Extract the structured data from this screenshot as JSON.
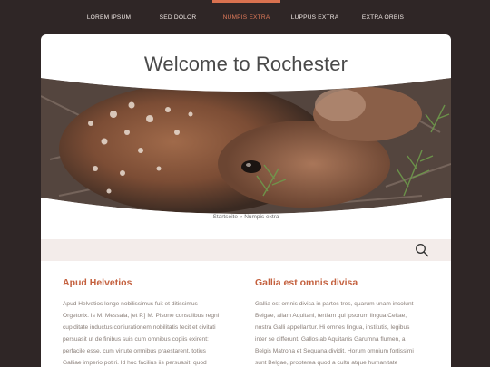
{
  "nav": {
    "items": [
      {
        "label": "LOREM IPSUM"
      },
      {
        "label": "SED DOLOR"
      },
      {
        "label": "NUMPIS EXTRA"
      },
      {
        "label": "LUPPUS EXTRA"
      },
      {
        "label": "EXTRA ORBIS"
      }
    ],
    "active_index": 2
  },
  "page": {
    "title": "Welcome to Rochester"
  },
  "breadcrumb": {
    "home": "Startseite",
    "separator": "»",
    "current": "Numpis extra"
  },
  "search": {
    "icon": "search-icon"
  },
  "columns": [
    {
      "heading": "Apud Helvetios",
      "lines": [
        "Apud Helvetios longe nobilissimus fuit et ditissimus",
        "Orgetorix. Is M. Messala, [et P.] M. Pisone consulibus regni",
        "cupiditate inductus coniurationem nobilitatis fecit et civitati",
        "persuasit ut de finibus suis cum omnibus copiis exirent:",
        "perfacile esse, cum virtute omnibus praestarent, totius",
        "Galliae imperio potiri. Id hoc facilius iis persuasit, quod"
      ]
    },
    {
      "heading": "Gallia est omnis divisa",
      "lines": [
        "Gallia est omnis divisa in partes tres, quarum unam incolunt",
        "Belgae, aliam Aquitani, tertiam qui ipsorum lingua Celtae,",
        "nostra Galli appellantur.  Hi omnes lingua, institutis, legibus",
        "inter se differunt. Gallos ab Aquitanis Garumna flumen, a",
        "Belgis Matrona et Sequana dividit. Horum omnium fortissimi",
        "sunt Belgae, propterea quod a cultu atque humanitate"
      ]
    }
  ],
  "colors": {
    "background": "#2f2626",
    "accent": "#d9714f",
    "heading": "#c4613f",
    "band": "#f3ecea"
  }
}
